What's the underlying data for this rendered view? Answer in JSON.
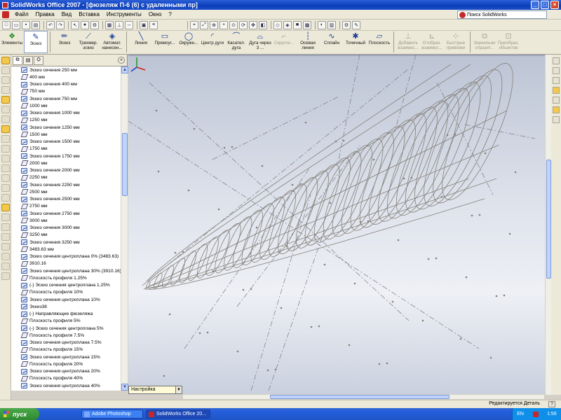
{
  "window": {
    "title": "SolidWorks Office 2007 - [фюзеляж П-6 (6) с удаленными пр]",
    "controls": {
      "minimize": "_",
      "maximize": "□",
      "close": "×"
    }
  },
  "menu": {
    "items": [
      "Файл",
      "Правка",
      "Вид",
      "Вставка",
      "Инструменты",
      "Окно",
      "?"
    ],
    "search_placeholder": "Поиск SolidWorks"
  },
  "command_manager": {
    "buttons": [
      {
        "label": "Элементы",
        "icon": "features-icon",
        "state": "normal"
      },
      {
        "label": "Эскиз",
        "icon": "sketch-tab-icon",
        "state": "selected"
      },
      {
        "label": "Эскиз",
        "icon": "sketch-icon",
        "state": "normal"
      },
      {
        "label": "Трехмер. эскиз",
        "icon": "3d-sketch-icon",
        "state": "normal"
      },
      {
        "label": "Автомат. нанесен...",
        "icon": "smart-dimension-icon",
        "state": "normal"
      },
      {
        "label": "Линия",
        "icon": "line-icon",
        "state": "normal"
      },
      {
        "label": "Прямоуг...",
        "icon": "rectangle-icon",
        "state": "normal"
      },
      {
        "label": "Окружн...",
        "icon": "circle-icon",
        "state": "normal"
      },
      {
        "label": "Центр дуги",
        "icon": "center-arc-icon",
        "state": "normal"
      },
      {
        "label": "Касател. дуга",
        "icon": "tangent-arc-icon",
        "state": "normal"
      },
      {
        "label": "Дуга через 3 ...",
        "icon": "three-point-arc-icon",
        "state": "normal"
      },
      {
        "label": "Скругле...",
        "icon": "fillet-icon",
        "state": "disabled"
      },
      {
        "label": "Осевая линия",
        "icon": "centerline-icon",
        "state": "normal"
      },
      {
        "label": "Сплайн",
        "icon": "spline-icon",
        "state": "normal"
      },
      {
        "label": "Точечный",
        "icon": "point-icon",
        "state": "normal"
      },
      {
        "label": "Плоскость",
        "icon": "plane-icon",
        "state": "normal"
      },
      {
        "label": "Добавить взаимос...",
        "icon": "add-relation-icon",
        "state": "disabled"
      },
      {
        "label": "Отобраз. взаимос...",
        "icon": "display-relations-icon",
        "state": "disabled"
      },
      {
        "label": "Быстрые привязки",
        "icon": "quick-snaps-icon",
        "state": "disabled"
      },
      {
        "label": "Зеркально отразит...",
        "icon": "mirror-icon",
        "state": "disabled"
      },
      {
        "label": "Преобраз. объектов",
        "icon": "convert-entities-icon",
        "state": "disabled"
      }
    ]
  },
  "feature_tree": {
    "items": [
      {
        "label": "Эскиз сечения 250 мм",
        "icon": "sketch"
      },
      {
        "label": "400 мм",
        "icon": "plane"
      },
      {
        "label": "Эскиз сечения 400 мм",
        "icon": "sketch"
      },
      {
        "label": "750 мм",
        "icon": "plane"
      },
      {
        "label": "Эскиз сечения 750 мм",
        "icon": "sketch"
      },
      {
        "label": "1000 мм",
        "icon": "plane"
      },
      {
        "label": "Эскиз сечения 1000 мм",
        "icon": "sketch"
      },
      {
        "label": "1250 мм",
        "icon": "plane"
      },
      {
        "label": "Эскиз сечения 1250 мм",
        "icon": "sketch"
      },
      {
        "label": "1500 мм",
        "icon": "plane"
      },
      {
        "label": "Эскиз сечения 1500 мм",
        "icon": "sketch"
      },
      {
        "label": "1750 мм",
        "icon": "plane"
      },
      {
        "label": "Эскиз сечения 1750 мм",
        "icon": "sketch"
      },
      {
        "label": "2000 мм",
        "icon": "plane"
      },
      {
        "label": "Эскиз сечения 2000 мм",
        "icon": "sketch"
      },
      {
        "label": "2250 мм",
        "icon": "plane"
      },
      {
        "label": "Эскиз сечения 2250 мм",
        "icon": "sketch"
      },
      {
        "label": "2500 мм",
        "icon": "plane"
      },
      {
        "label": "Эскиз сечения 2500 мм",
        "icon": "sketch"
      },
      {
        "label": "2750 мм",
        "icon": "plane"
      },
      {
        "label": "Эскиз сечения 2750 мм",
        "icon": "sketch"
      },
      {
        "label": "3000 мм",
        "icon": "plane"
      },
      {
        "label": "Эскиз сечения 3000 мм",
        "icon": "sketch"
      },
      {
        "label": "3250 мм",
        "icon": "plane"
      },
      {
        "label": "Эскиз сечения 3250 мм",
        "icon": "sketch"
      },
      {
        "label": "3483.63 мм",
        "icon": "plane"
      },
      {
        "label": "Эскиз сечения центроплана 0% (3483.63)",
        "icon": "sketch"
      },
      {
        "label": "3910.16",
        "icon": "plane"
      },
      {
        "label": "Эскиз сечения  центроплана 30% (3910.16)",
        "icon": "sketch"
      },
      {
        "label": "Плоскость профиля 1.25%",
        "icon": "plane"
      },
      {
        "label": "(-) Эскиз сечения центроплана 1.25%",
        "icon": "sketch"
      },
      {
        "label": "Плоскость профиля 10%",
        "icon": "plane"
      },
      {
        "label": "Эскиз сечения центроплана 10%",
        "icon": "sketch"
      },
      {
        "label": "Эскиз38",
        "icon": "sketch"
      },
      {
        "label": "(-) Направляющие фюзеляжа",
        "icon": "sketch"
      },
      {
        "label": "Плоскость профиля 5%",
        "icon": "plane"
      },
      {
        "label": "(-) Эскиз сечения центроплана 5%",
        "icon": "sketch"
      },
      {
        "label": "Плоскость профиля 7.5%",
        "icon": "plane"
      },
      {
        "label": "Эскиз сечения центроплана 7.5%",
        "icon": "sketch"
      },
      {
        "label": "Плоскость профиля 15%",
        "icon": "plane"
      },
      {
        "label": "Эскиз сечения центроплана 15%",
        "icon": "sketch"
      },
      {
        "label": "Плоскость профиля 20%",
        "icon": "plane"
      },
      {
        "label": "Эскиз сечения центроплана 20%",
        "icon": "sketch"
      },
      {
        "label": "Плоскость профиля 40%",
        "icon": "plane"
      },
      {
        "label": "Эскиз сечения центроплана 40%",
        "icon": "sketch"
      }
    ]
  },
  "config_label": "Настройка",
  "status": {
    "text": "Редактируется Деталь",
    "help": "?"
  },
  "taskbar": {
    "start": "пуск",
    "tasks": [
      {
        "label": "Adobe Photoshop",
        "active": false
      },
      {
        "label": "SolidWorks Office 20...",
        "active": true
      }
    ],
    "lang": "EN",
    "clock": "1:56"
  },
  "colors": {
    "title_blue": "#0b3db8",
    "wire": "#85807a",
    "axis_dash": "#7a7a86"
  }
}
